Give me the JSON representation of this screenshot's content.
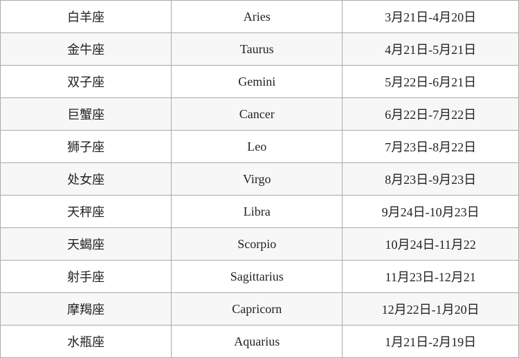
{
  "table": {
    "rows": [
      {
        "chinese": "白羊座",
        "english": "Aries",
        "dates": "3月21日-4月20日"
      },
      {
        "chinese": "金牛座",
        "english": "Taurus",
        "dates": "4月21日-5月21日"
      },
      {
        "chinese": "双子座",
        "english": "Gemini",
        "dates": "5月22日-6月21日"
      },
      {
        "chinese": "巨蟹座",
        "english": "Cancer",
        "dates": "6月22日-7月22日"
      },
      {
        "chinese": "狮子座",
        "english": "Leo",
        "dates": "7月23日-8月22日"
      },
      {
        "chinese": "处女座",
        "english": "Virgo",
        "dates": "8月23日-9月23日"
      },
      {
        "chinese": "天秤座",
        "english": "Libra",
        "dates": "9月24日-10月23日"
      },
      {
        "chinese": "天蝎座",
        "english": "Scorpio",
        "dates": "10月24日-11月22"
      },
      {
        "chinese": "射手座",
        "english": "Sagittarius",
        "dates": "11月23日-12月21"
      },
      {
        "chinese": "摩羯座",
        "english": "Capricorn",
        "dates": "12月22日-1月20日"
      },
      {
        "chinese": "水瓶座",
        "english": "Aquarius",
        "dates": "1月21日-2月19日"
      }
    ]
  }
}
